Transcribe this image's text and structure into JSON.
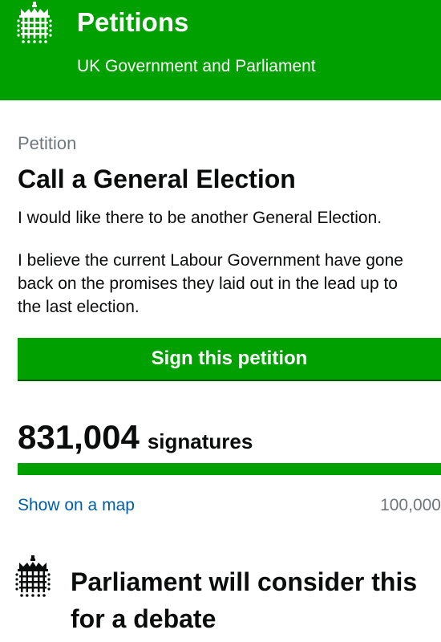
{
  "header": {
    "title": "Petitions",
    "subtitle": "UK Government and Parliament",
    "logo_icon": "portcullis-icon",
    "background_color": "#00a000"
  },
  "petition": {
    "kicker": "Petition",
    "title": "Call a General Election",
    "summary": "I would like there to be another General Election.",
    "details": "I believe the current Labour Government have gone back on the promises they laid out in the lead up to the last election.",
    "sign_button_label": "Sign this petition"
  },
  "signatures": {
    "count": "831,004",
    "label": "signatures",
    "progress_fraction": 1.0,
    "map_link_label": "Show on a map",
    "threshold_label": "100,000"
  },
  "debate": {
    "icon": "portcullis-icon",
    "text": "Parliament will consider this for a debate"
  },
  "colors": {
    "brand_green": "#00a000",
    "link_blue": "#005ea5",
    "secondary_grey": "#6f777b",
    "track_grey": "#dee0e2",
    "text_black": "#0b0c0c"
  }
}
